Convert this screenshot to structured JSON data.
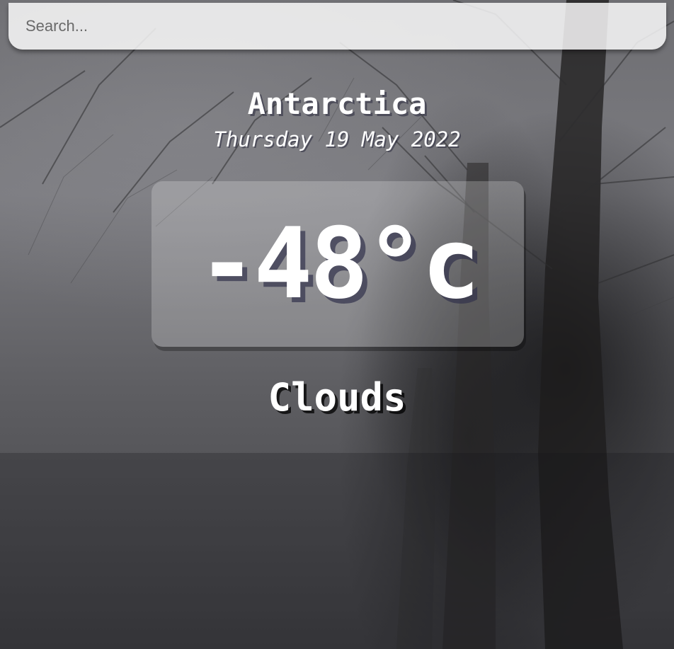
{
  "search": {
    "placeholder": "Search...",
    "value": ""
  },
  "location": {
    "name": "Antarctica",
    "date": "Thursday 19 May 2022"
  },
  "weather": {
    "temperature": "-48°c",
    "condition": "Clouds"
  },
  "background": {
    "scene": "foggy-snowy-forest"
  }
}
